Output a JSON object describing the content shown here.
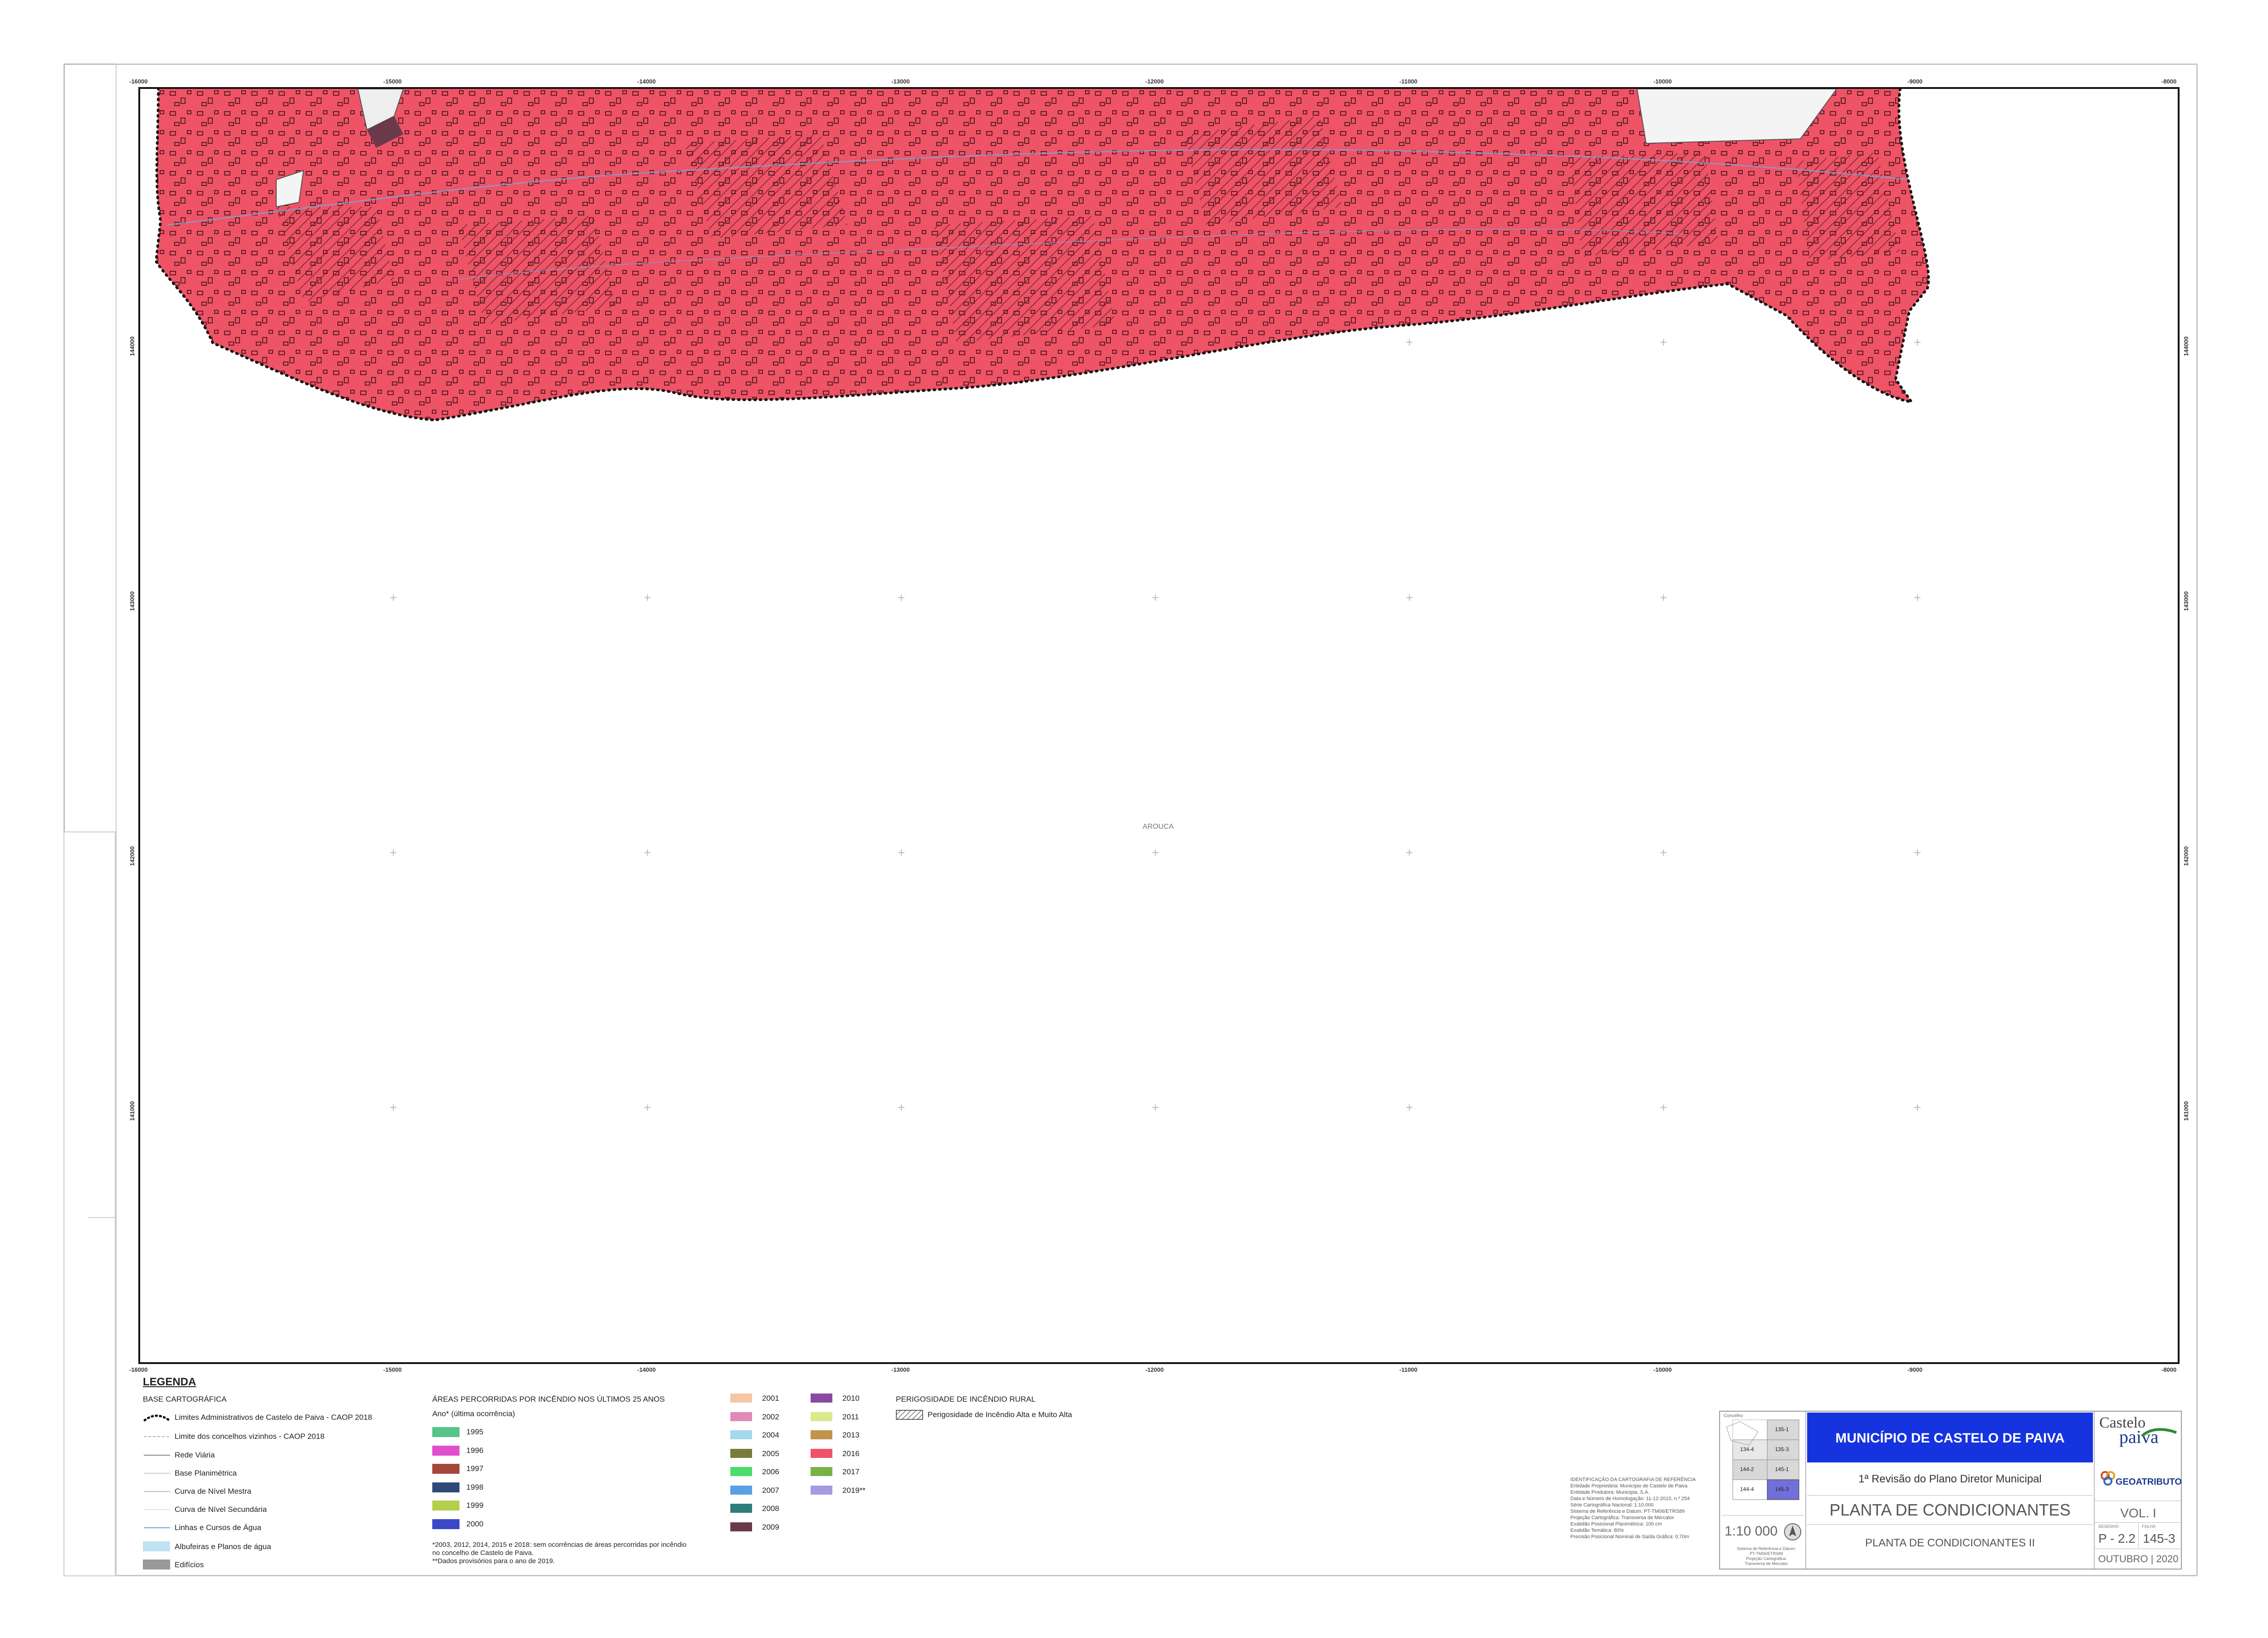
{
  "map": {
    "neighbor_label": "AROUCA",
    "x_ticks": [
      "-16000",
      "-15000",
      "-14000",
      "-13000",
      "-12000",
      "-11000",
      "-10000",
      "-9000",
      "-8000"
    ],
    "y_ticks": [
      "144000",
      "143000",
      "142000",
      "141000"
    ],
    "colors": {
      "burn_area": "#ee5366",
      "outline": "#1a1a1a",
      "hatch": "#5a1c28"
    }
  },
  "legend": {
    "title": "LEGENDA",
    "base": {
      "heading": "BASE CARTOGRÁFICA",
      "items": [
        {
          "label": "Limites Administrativos de Castelo de Paiva - CAOP 2018",
          "icon": "dotted-boundary-icon"
        },
        {
          "label": "Limite dos concelhos vizinhos  - CAOP 2018",
          "icon": "thin-line-icon"
        },
        {
          "label": "Rede Viária",
          "icon": "road-line-icon"
        },
        {
          "label": "Base Planimétrica",
          "icon": "thin-line-icon"
        },
        {
          "label": "Curva de Nível Mestra",
          "icon": "contour-line-icon"
        },
        {
          "label": "Curva de Nível Secundária",
          "icon": "contour-line-icon"
        },
        {
          "label": "Linhas e Cursos de Água",
          "icon": "water-line-icon"
        },
        {
          "label": "Albufeiras e Planos de água",
          "color": "#bfe3f2"
        },
        {
          "label": "Edifícios",
          "color": "#999999"
        }
      ]
    },
    "burned": {
      "heading": "ÁREAS PERCORRIDAS POR INCÊNDIO NOS ÚLTIMOS 25 ANOS",
      "sub": "Ano* (última ocorrência)",
      "col1": [
        {
          "label": "1995",
          "color": "#55c48a"
        },
        {
          "label": "1996",
          "color": "#e04fd0"
        },
        {
          "label": "1997",
          "color": "#a4483c"
        },
        {
          "label": "1998",
          "color": "#2f4a7a"
        },
        {
          "label": "1999",
          "color": "#b2d04a"
        },
        {
          "label": "2000",
          "color": "#3b48c8"
        }
      ],
      "col2": [
        {
          "label": "2001",
          "color": "#f5c6a4"
        },
        {
          "label": "2002",
          "color": "#e08ab8"
        },
        {
          "label": "2004",
          "color": "#a6d8ee"
        },
        {
          "label": "2005",
          "color": "#7a7a3c"
        },
        {
          "label": "2006",
          "color": "#4bdc6c"
        },
        {
          "label": "2007",
          "color": "#5aa0e6"
        },
        {
          "label": "2008",
          "color": "#2f7c7c"
        },
        {
          "label": "2009",
          "color": "#6a3a4a"
        }
      ],
      "col3": [
        {
          "label": "2010",
          "color": "#8a4aa4"
        },
        {
          "label": "2011",
          "color": "#dce88c"
        },
        {
          "label": "2013",
          "color": "#c0944c"
        },
        {
          "label": "2016",
          "color": "#ee5366"
        },
        {
          "label": "2017",
          "color": "#7ab048"
        },
        {
          "label": "2019**",
          "color": "#a898e0"
        }
      ],
      "footnotes": [
        "*2003, 2012, 2014, 2015 e 2018: sem ocorrências de áreas percorridas por incêndio",
        "no concelho de Castelo de Paiva.",
        "**Dados provisórios para o ano de 2019."
      ]
    },
    "hazard": {
      "heading": "PERIGOSIDADE DE INCÊNDIO RURAL",
      "item": "Perigosidade de Incêndio Alta e Muito Alta"
    }
  },
  "title_block": {
    "municipality": "MUNICÍPIO DE CASTELO DE PAIVA",
    "revision": "1ª Revisão do Plano Diretor Municipal",
    "plan_title": "PLANTA DE CONDICIONANTES",
    "plan_subtitle": "PLANTA DE CONDICIONANTES II",
    "scale": "1:10 000",
    "volume": "VOL. I",
    "drawing_label": "DESENHO",
    "drawing": "P - 2.2",
    "sheet_label": "FOLHA",
    "sheet": "145-3",
    "date": "OUTUBRO | 2020",
    "logo_castelo": "Castelo",
    "logo_paiva": "paiva",
    "logo_geo": "GEOATRIBUTO",
    "index_grid": [
      [
        "",
        "135-1"
      ],
      [
        "134-4",
        "135-3"
      ],
      [
        "144-2",
        "145-1"
      ],
      [
        "144-4",
        "145-3"
      ]
    ],
    "index_label": "Concelho",
    "id_lines": [
      "IDENTIFICAÇÃO DA CARTOGRAFIA DE REFERÊNCIA",
      "Entidade Proprietária: Município de Castelo de Paiva",
      "Entidade Produtora: Municipia, S.A.",
      "Data e Número de Homologação: 11-12-2015, n.º 254",
      "Série Cartográfica Nacional: 1:10.000",
      "Sistema de Referência e Datum: PT-TM06/ETRS89",
      "Projeção Cartográfica: Transversa de Mercator",
      "Exatidão Posicional Planimétrica: 100 cm",
      "Exatidão Temática: 80%",
      "Precisão Posicional Nominal de Saída Gráfica: 0,70m"
    ],
    "scale_notes": [
      "Sistema de Referência e Datum:",
      "PT-TM06/ETRS89",
      "Projeção Cartográfica:",
      "Transversa de Mercator"
    ]
  }
}
